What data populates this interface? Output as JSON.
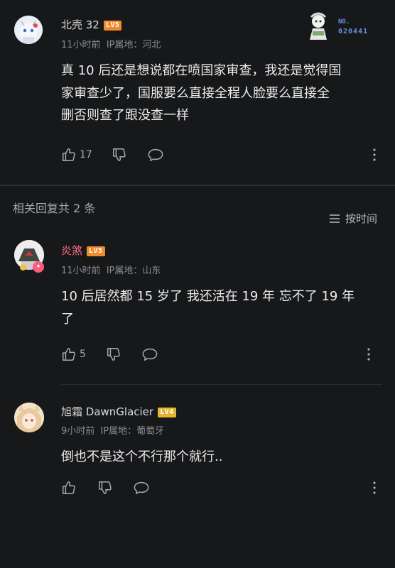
{
  "main_comment": {
    "user": "北壳 32",
    "level": "LV5",
    "time": "11小时前",
    "ip": "IP属地：河北",
    "content": [
      "真 10 后还是想说都在喷国家审查，我还是觉得国",
      "家审查少了，国服要么直接全程人脸要么直接全",
      "删否则查了跟没查一样"
    ],
    "likes": "17",
    "badge_label": "NO.",
    "badge_number": "020441"
  },
  "replies_header": {
    "title": "相关回复共 2 条",
    "sort_label": "按时间"
  },
  "replies": [
    {
      "user": "炎煞",
      "level": "LV5",
      "time": "11小时前",
      "ip": "IP属地：山东",
      "content": [
        "10 后居然都 15 岁了 我还活在 19 年 忘不了 19 年",
        "了"
      ],
      "likes": "5",
      "name_color": "#ff6b8b"
    },
    {
      "user": "旭霜 DawnGlacier",
      "level": "LV4",
      "time": "9小时前",
      "ip": "IP属地：葡萄牙",
      "content": [
        "倒也不是这个不行那个就行.."
      ],
      "likes": ""
    }
  ],
  "colors": {
    "background": "#17181a",
    "level5": "#f08b2a",
    "level4": "#e6b333",
    "meta": "#8a8b8f"
  }
}
